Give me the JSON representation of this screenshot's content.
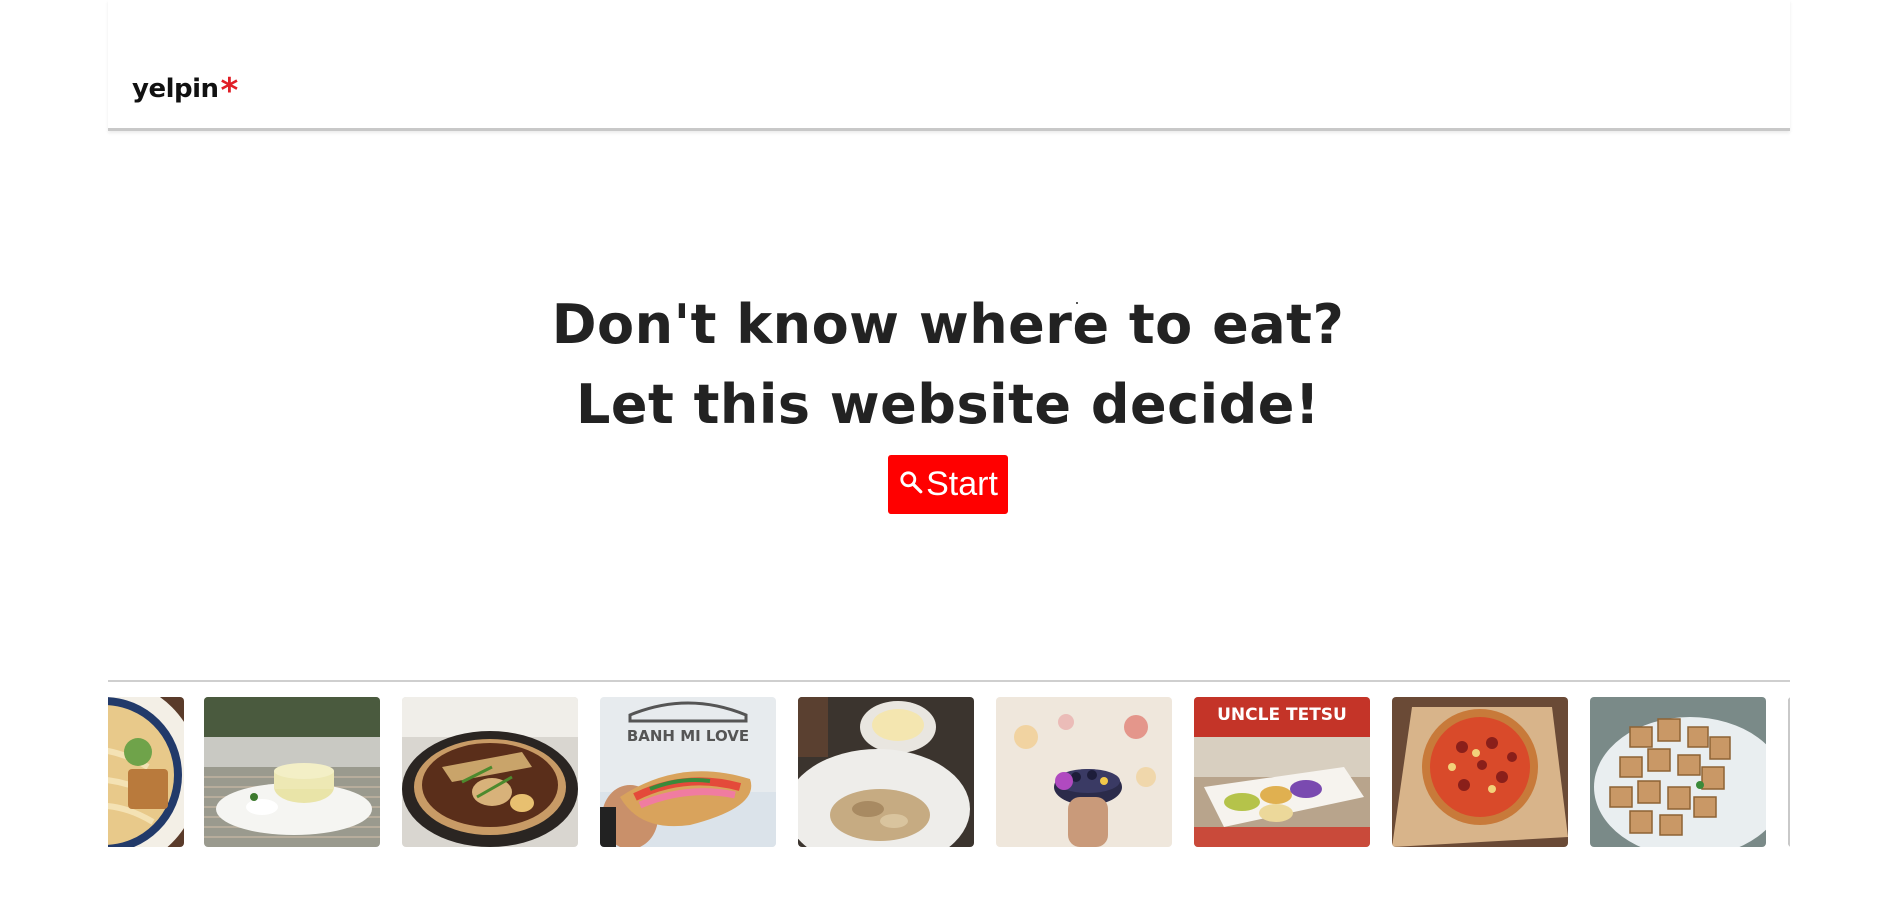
{
  "header": {
    "logo_text": "yelpin",
    "logo_star": "*",
    "logo_star_color": "#e01e26"
  },
  "hero": {
    "line1": "Don't know where to eat?",
    "line2": "Let this website decide!",
    "start_button": {
      "icon": "search-icon",
      "label": "Start",
      "color": "#ff0000"
    }
  },
  "gallery": {
    "items": [
      {
        "name": "noodle-bowl-photo"
      },
      {
        "name": "cheesecake-plate-photo"
      },
      {
        "name": "stew-pot-photo"
      },
      {
        "name": "banh-mi-photo",
        "sign_text": "BANH MI LOVE"
      },
      {
        "name": "rice-bowl-photo"
      },
      {
        "name": "acai-bowl-photo"
      },
      {
        "name": "uncle-tetsu-photo",
        "sign_text": "UNCLE TETSU"
      },
      {
        "name": "pizza-photo"
      },
      {
        "name": "fried-tofu-photo"
      },
      {
        "name": "partial-photo"
      }
    ]
  }
}
